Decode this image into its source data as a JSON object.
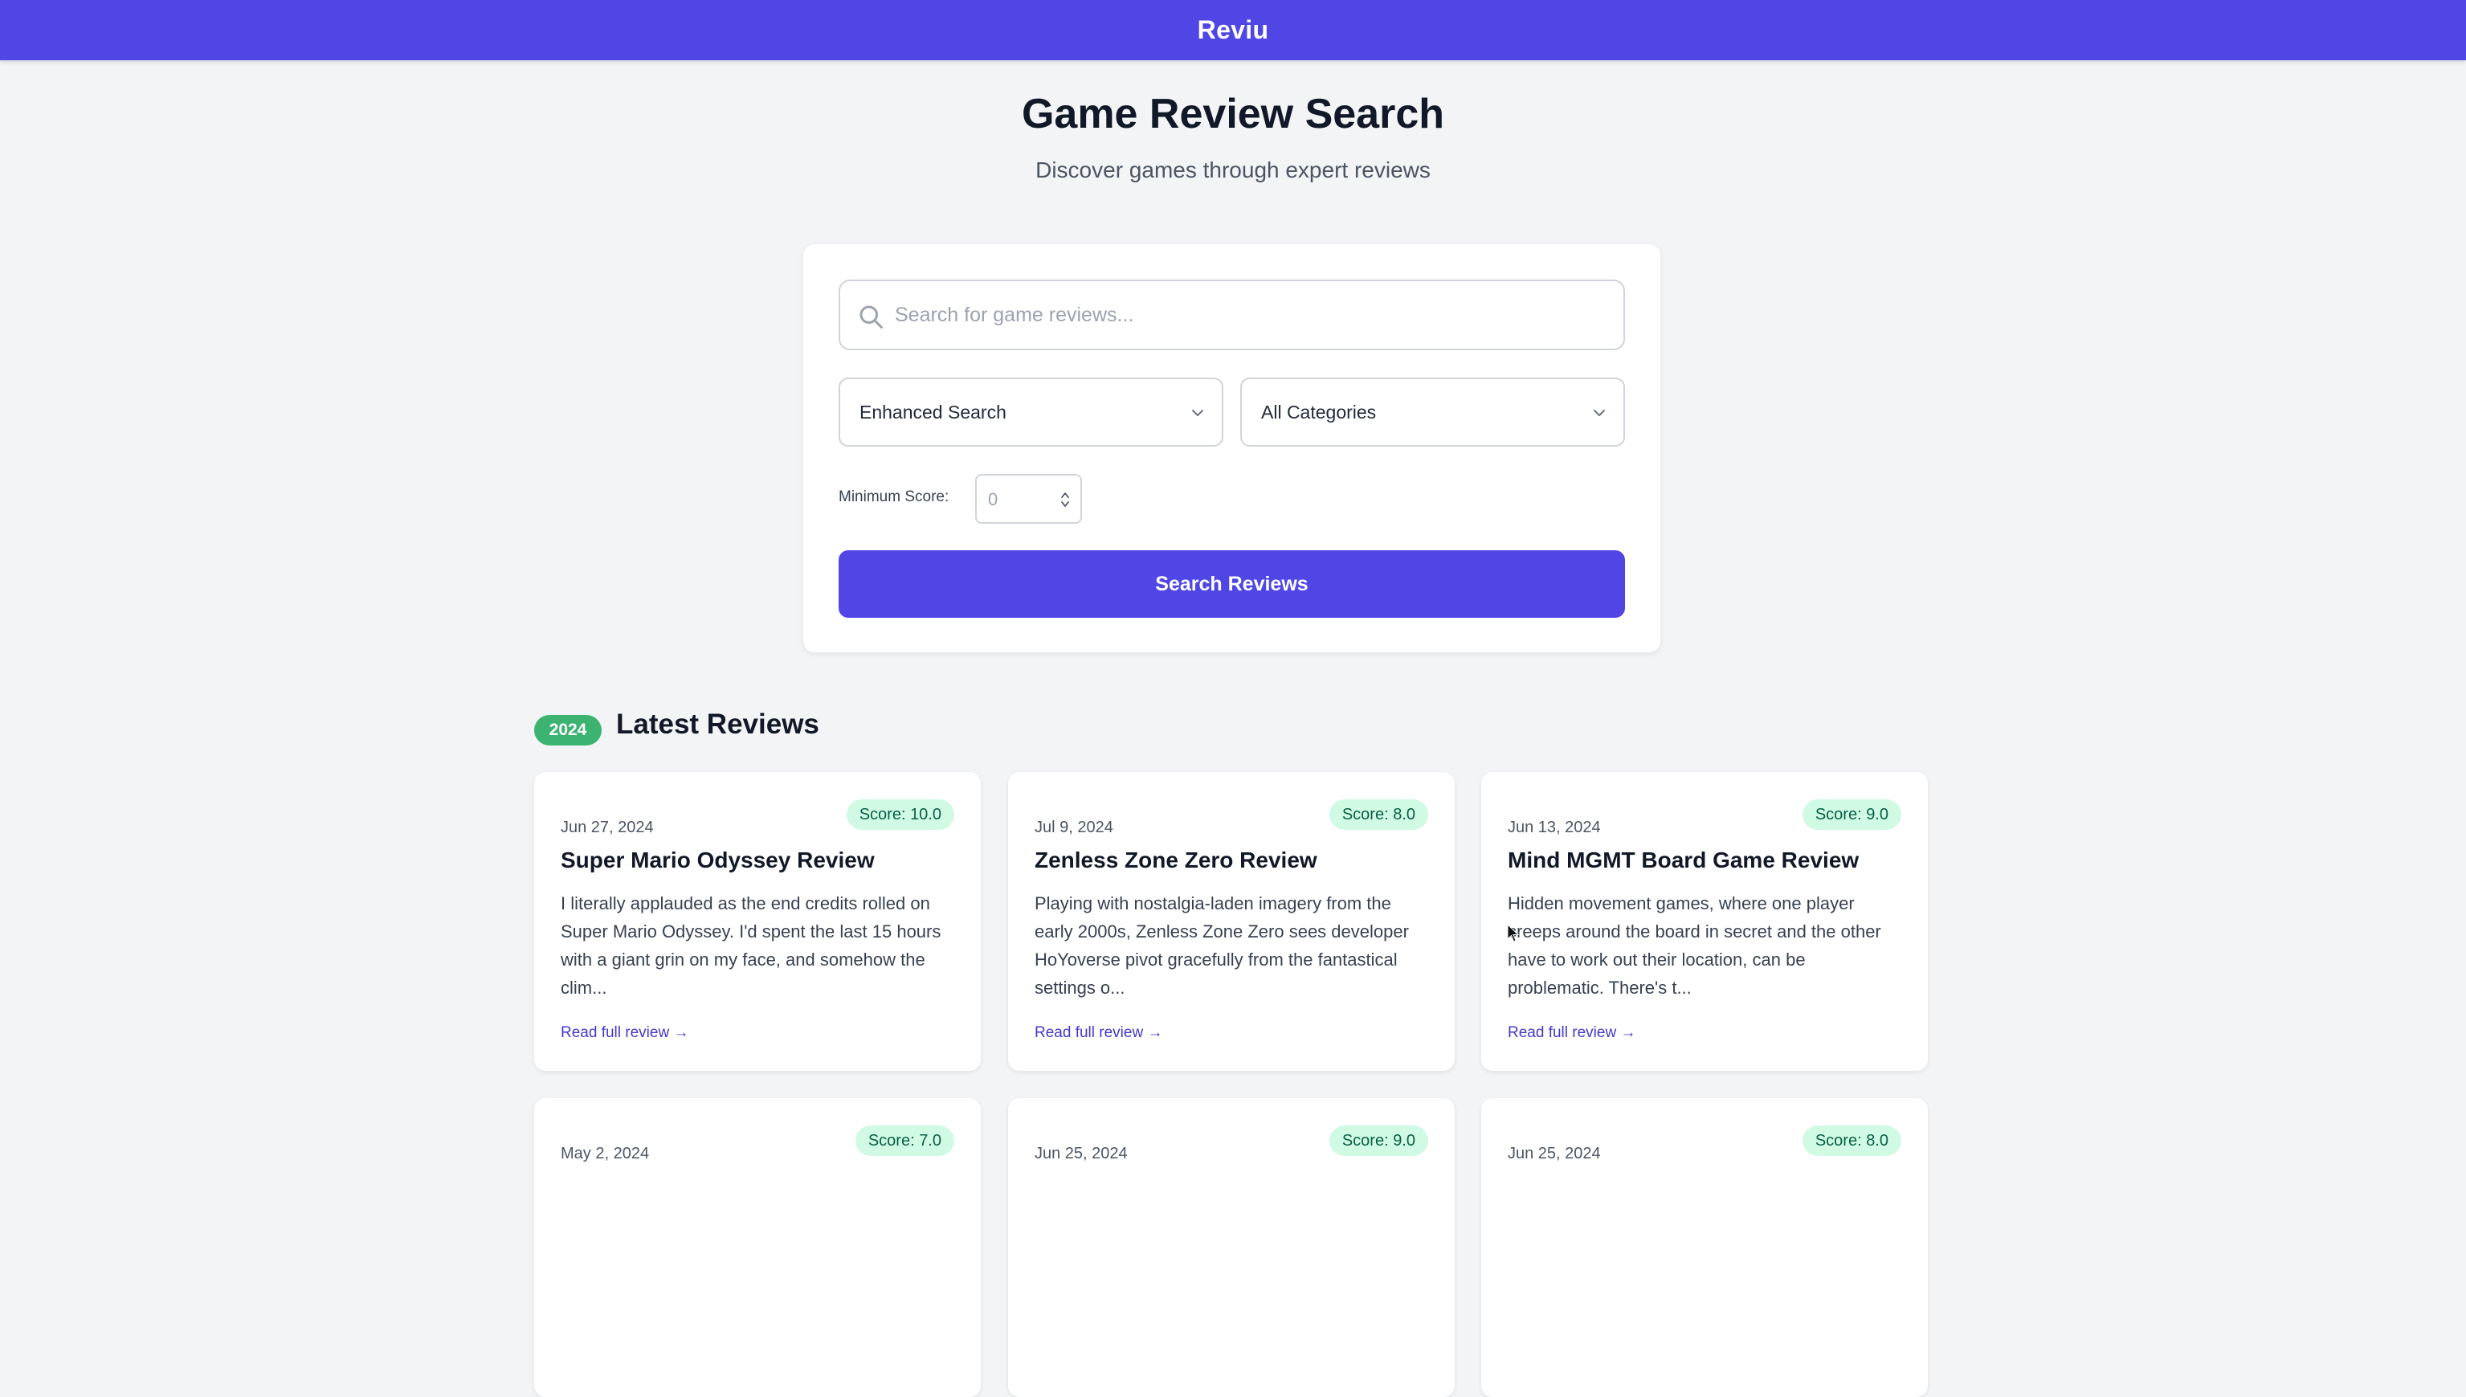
{
  "app": {
    "title": "Reviu"
  },
  "header": {
    "title": "Game Review Search",
    "subtitle": "Discover games through expert reviews"
  },
  "search": {
    "placeholder": "Search for game reviews...",
    "value": "",
    "icon": "search-icon",
    "mode_select": {
      "selected": "Enhanced Search"
    },
    "category_select": {
      "selected": "All Categories"
    },
    "min_score_label": "Minimum Score:",
    "min_score_value": "0",
    "button_label": "Search Reviews"
  },
  "latest": {
    "year_badge": "2024",
    "title": "Latest Reviews",
    "read_more_label": "Read full review →",
    "reviews": [
      {
        "score": "Score: 10.0",
        "date": "Jun 27, 2024",
        "title": "Super Mario Odyssey Review",
        "excerpt": "I literally applauded as the end credits rolled on Super Mario Odyssey. I'd spent the last 15 hours with a giant grin on my face, and somehow the clim..."
      },
      {
        "score": "Score: 8.0",
        "date": "Jul 9, 2024",
        "title": "Zenless Zone Zero Review",
        "excerpt": "Playing with nostalgia-laden imagery from the early 2000s, Zenless Zone Zero sees developer HoYoverse pivot gracefully from the fantastical settings o..."
      },
      {
        "score": "Score: 9.0",
        "date": "Jun 13, 2024",
        "title": "Mind MGMT Board Game Review",
        "excerpt": "Hidden movement games, where one player creeps around the board in secret and the other have to work out their location, can be problematic. There's t..."
      },
      {
        "score": "Score: 7.0",
        "date": "May 2, 2024"
      },
      {
        "score": "Score: 9.0",
        "date": "Jun 25, 2024"
      },
      {
        "score": "Score: 8.0",
        "date": "Jun 25, 2024"
      }
    ]
  },
  "colors": {
    "brand": "#4f46e5",
    "background": "#f3f4f6",
    "year_badge": "#3cb371",
    "score_badge_bg": "#d1fae5",
    "score_badge_text": "#065f46",
    "link": "#4338ca"
  }
}
